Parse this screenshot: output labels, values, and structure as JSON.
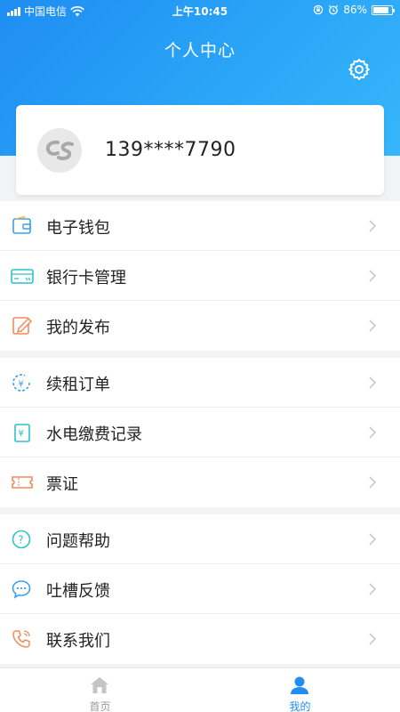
{
  "status_bar": {
    "carrier": "中国电信",
    "time": "上午10:45",
    "battery": "86%",
    "battery_level": 0.86
  },
  "header": {
    "title": "个人中心",
    "settings_icon": "gear-icon"
  },
  "profile": {
    "avatar_icon": "cs-logo",
    "phone": "139****7790"
  },
  "menu_groups": [
    [
      {
        "label": "电子钱包",
        "icon": "wallet-icon"
      },
      {
        "label": "银行卡管理",
        "icon": "bank-card-icon"
      },
      {
        "label": "我的发布",
        "icon": "edit-icon"
      }
    ],
    [
      {
        "label": "续租订单",
        "icon": "renewal-icon"
      },
      {
        "label": "水电缴费记录",
        "icon": "bill-icon"
      },
      {
        "label": "票证",
        "icon": "ticket-icon"
      }
    ],
    [
      {
        "label": "问题帮助",
        "icon": "help-icon"
      },
      {
        "label": "吐槽反馈",
        "icon": "feedback-icon"
      },
      {
        "label": "联系我们",
        "icon": "phone-icon"
      }
    ]
  ],
  "tabbar": {
    "home_label": "首页",
    "mine_label": "我的"
  },
  "colors": {
    "primary": "#1f8df2",
    "icon_blue": "#3aa0f0",
    "icon_cyan": "#2cc2c7",
    "icon_orange": "#f28a5a"
  }
}
